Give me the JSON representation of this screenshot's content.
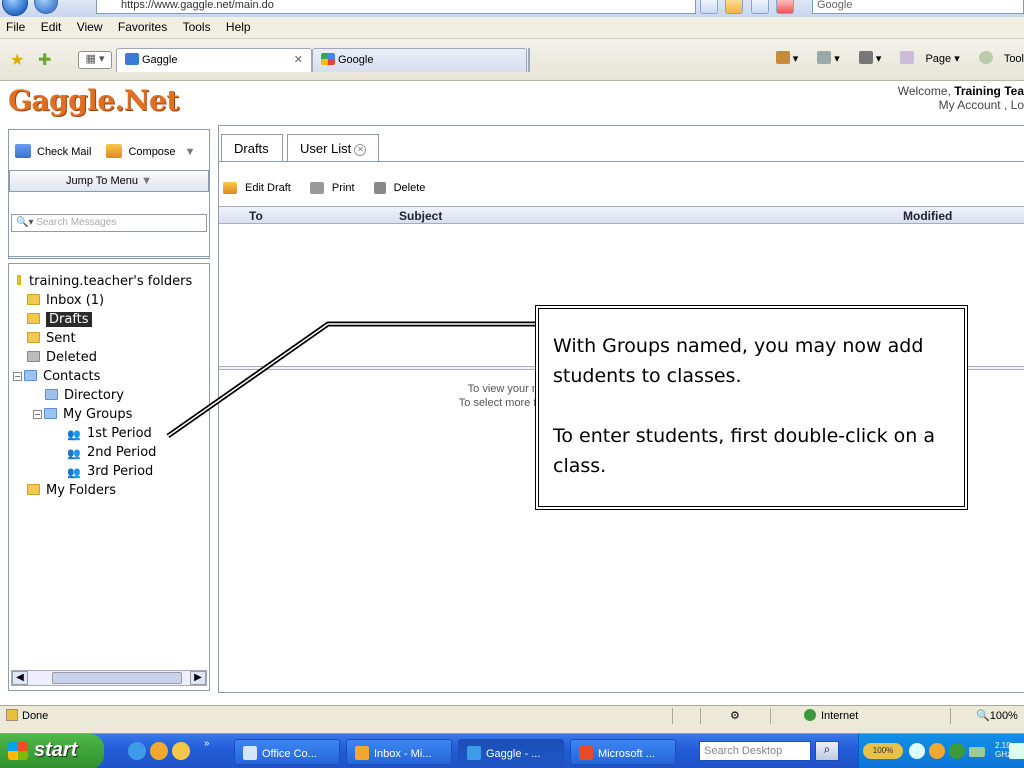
{
  "browser": {
    "address": "https://www.gaggle.net/main.do",
    "search_placeholder": "Google",
    "menu": [
      "File",
      "Edit",
      "View",
      "Favorites",
      "Tools",
      "Help"
    ],
    "tabs": [
      {
        "label": "Gaggle",
        "active": true
      },
      {
        "label": "Google",
        "active": false
      }
    ],
    "commands": {
      "page": "Page",
      "tools": "Tool"
    }
  },
  "header": {
    "logo": "Gaggle.Net",
    "welcome_prefix": "Welcome, ",
    "welcome_name": "Training Tea",
    "account_links": "My Account , Lo"
  },
  "left_panel": {
    "check_mail": "Check Mail",
    "compose": "Compose",
    "jump_menu": "Jump To Menu",
    "search_placeholder": "Search Messages"
  },
  "folders": {
    "root": "training.teacher's folders",
    "inbox": "Inbox (1)",
    "drafts": "Drafts",
    "sent": "Sent",
    "deleted": "Deleted",
    "contacts": "Contacts",
    "directory": "Directory",
    "my_groups": "My Groups",
    "groups": [
      "1st Period",
      "2nd Period",
      "3rd Period"
    ],
    "my_folders": "My Folders"
  },
  "main": {
    "tabs": [
      {
        "label": "Drafts"
      },
      {
        "label": "User List"
      }
    ],
    "toolbar": {
      "edit": "Edit Draft",
      "print": "Print",
      "delete": "Delete"
    },
    "columns": {
      "to": "To",
      "subject": "Subject",
      "modified": "Modified"
    },
    "preview_line1": "To view your messag",
    "preview_line2": "To select more than one,"
  },
  "callout": {
    "para1": "With Groups named, you may now add students to classes.",
    "para2": "To enter students, first double-click on a class."
  },
  "status": {
    "done": "Done",
    "zone": "Internet",
    "zoom": "100%"
  },
  "taskbar": {
    "start": "start",
    "tasks": [
      {
        "label": "Office Co...",
        "active": false
      },
      {
        "label": "Inbox - Mi...",
        "active": false
      },
      {
        "label": "Gaggle - ...",
        "active": true
      },
      {
        "label": "Microsoft ...",
        "active": false
      }
    ],
    "search_placeholder": "Search Desktop",
    "battery": "100%",
    "cpu": "2.19",
    "cpu_unit": "GHz"
  }
}
